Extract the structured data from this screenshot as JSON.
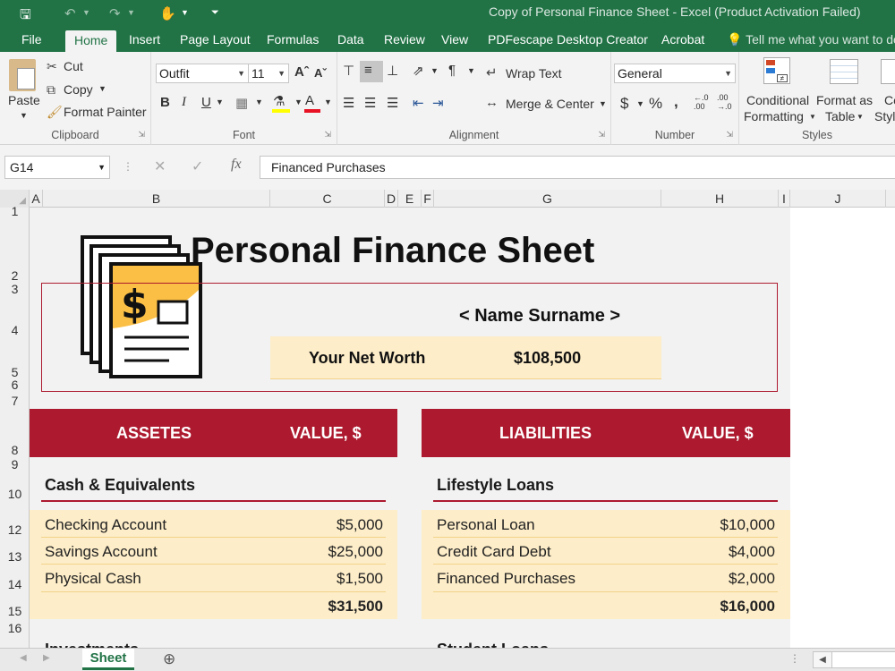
{
  "window": {
    "title": "Copy of Personal Finance Sheet - Excel (Product Activation Failed)"
  },
  "tabs": [
    "File",
    "Home",
    "Insert",
    "Page Layout",
    "Formulas",
    "Data",
    "Review",
    "View",
    "PDFescape Desktop Creator",
    "Acrobat"
  ],
  "tell_me": "Tell me what you want to do",
  "ribbon": {
    "clipboard": {
      "paste": "Paste",
      "cut": "Cut",
      "copy": "Copy",
      "format_painter": "Format Painter",
      "label": "Clipboard"
    },
    "font": {
      "name": "Outfit",
      "size": "11",
      "label": "Font"
    },
    "alignment": {
      "wrap": "Wrap Text",
      "merge": "Merge & Center",
      "label": "Alignment"
    },
    "number": {
      "format": "General",
      "label": "Number"
    },
    "styles": {
      "conditional_1": "Conditional",
      "conditional_2": "Formatting",
      "format_table_1": "Format as",
      "format_table_2": "Table",
      "cell_styles_1": "Ce",
      "cell_styles_2": "Styl",
      "label": "Styles"
    }
  },
  "formula_bar": {
    "name_box": "G14",
    "content": "Financed Purchases"
  },
  "columns": [
    "A",
    "B",
    "C",
    "D",
    "E",
    "F",
    "G",
    "H",
    "I",
    "J"
  ],
  "rows": [
    "1",
    "2",
    "3",
    "4",
    "5",
    "6",
    "7",
    "8",
    "9",
    "10",
    "12",
    "13",
    "14",
    "15",
    "16"
  ],
  "sheet": {
    "title": "Personal Finance Sheet",
    "name": "< Name Surname >",
    "net_worth_label": "Your Net Worth",
    "net_worth_value": "$108,500",
    "assets_header": "ASSETES",
    "assets_value_header": "VALUE, $",
    "liabilities_header": "LIABILITIES",
    "liabilities_value_header": "VALUE, $",
    "assets_section": "Cash & Equivalents",
    "liabilities_section": "Lifestyle Loans",
    "assets": [
      {
        "label": "Checking Account",
        "value": "$5,000"
      },
      {
        "label": "Savings Account",
        "value": "$25,000"
      },
      {
        "label": "Physical Cash",
        "value": "$1,500"
      }
    ],
    "assets_total": "$31,500",
    "liabilities": [
      {
        "label": "Personal Loan",
        "value": "$10,000"
      },
      {
        "label": "Credit Card Debt",
        "value": "$4,000"
      },
      {
        "label": "Financed Purchases",
        "value": "$2,000"
      }
    ],
    "liabilities_total": "$16,000",
    "next_section_left": "Investments",
    "next_section_right": "Student Loans"
  },
  "sheet_tab": "Sheet",
  "colors": {
    "excel_green": "#217346",
    "header_red": "#ad1a2f",
    "cream": "#fdedc8"
  }
}
